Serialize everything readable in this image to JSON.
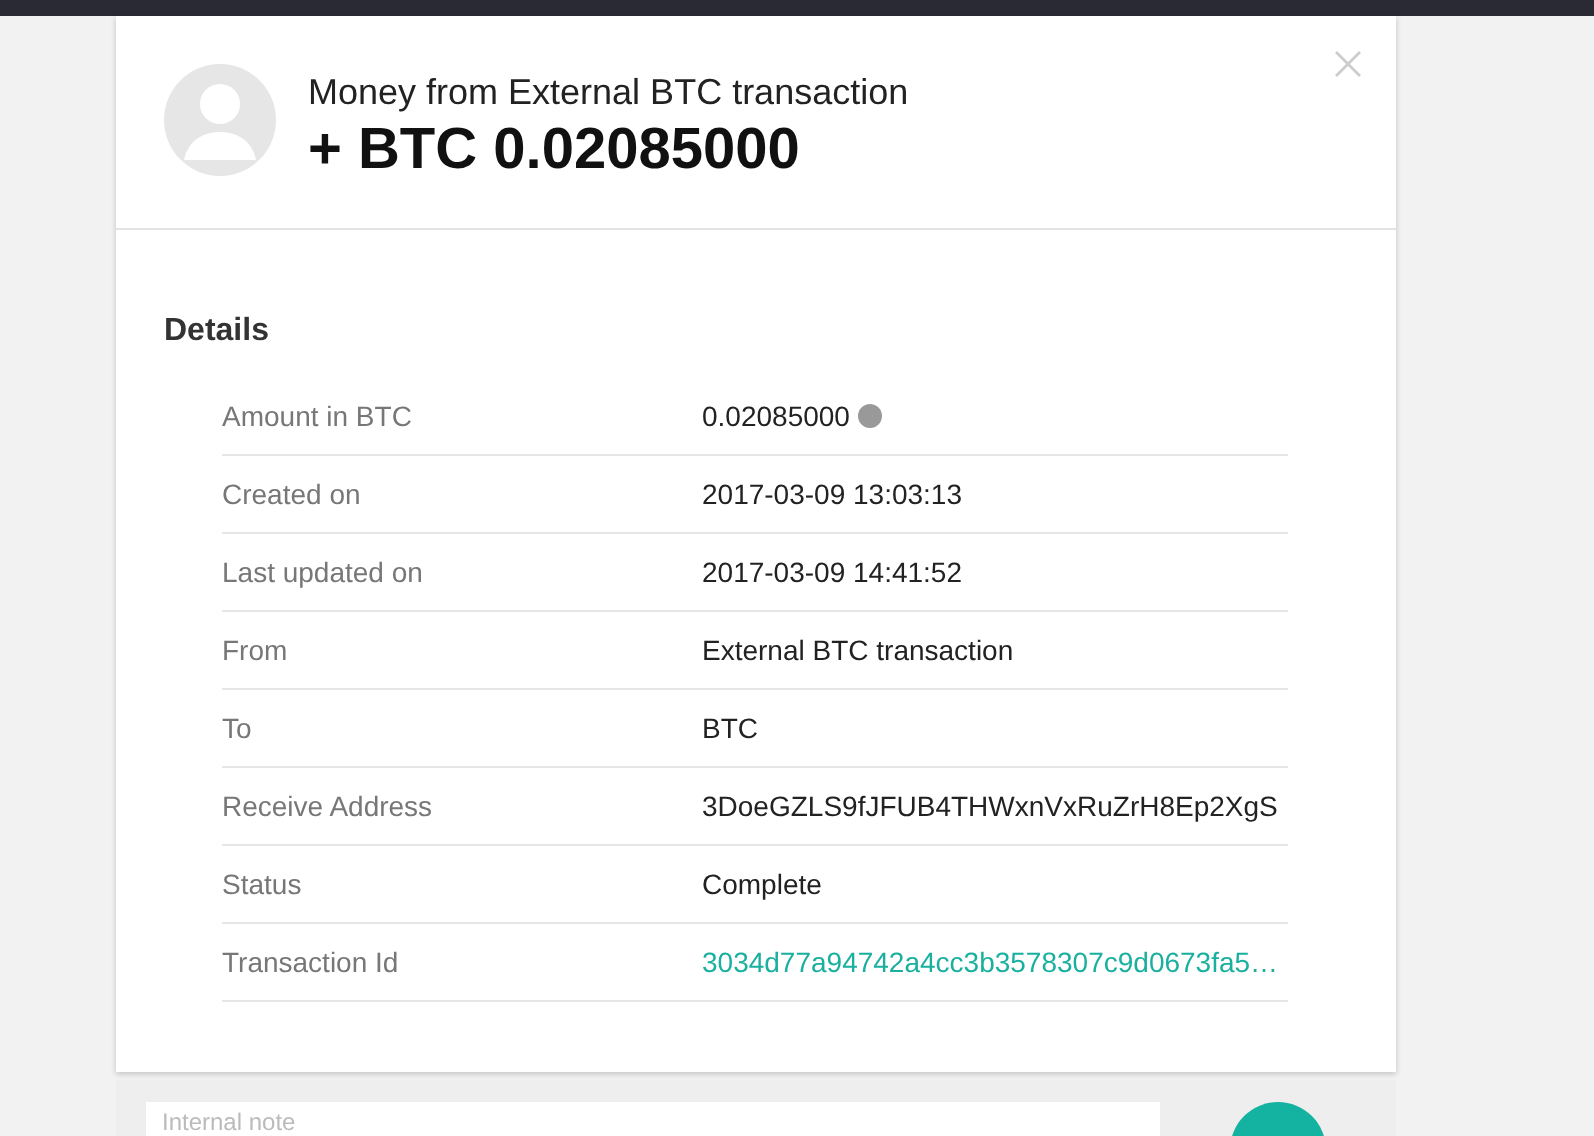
{
  "header": {
    "title": "Money from External BTC transaction",
    "amount": "+ BTC 0.02085000"
  },
  "details": {
    "title": "Details",
    "rows": [
      {
        "label": "Amount in BTC",
        "value": "0.02085000",
        "kind": "help"
      },
      {
        "label": "Created on",
        "value": "2017-03-09 13:03:13",
        "kind": "text"
      },
      {
        "label": "Last updated on",
        "value": "2017-03-09 14:41:52",
        "kind": "text"
      },
      {
        "label": "From",
        "value": "External BTC transaction",
        "kind": "text"
      },
      {
        "label": "To",
        "value": "BTC",
        "kind": "text"
      },
      {
        "label": "Receive Address",
        "value": "3DoeGZLS9fJFUB4THWxnVxRuZrH8Ep2XgS",
        "kind": "text"
      },
      {
        "label": "Status",
        "value": "Complete",
        "kind": "text"
      },
      {
        "label": "Transaction Id",
        "value": "3034d77a94742a4cc3b3578307c9d0673fa5…",
        "kind": "link"
      }
    ]
  },
  "note": {
    "placeholder": "Internal note"
  }
}
